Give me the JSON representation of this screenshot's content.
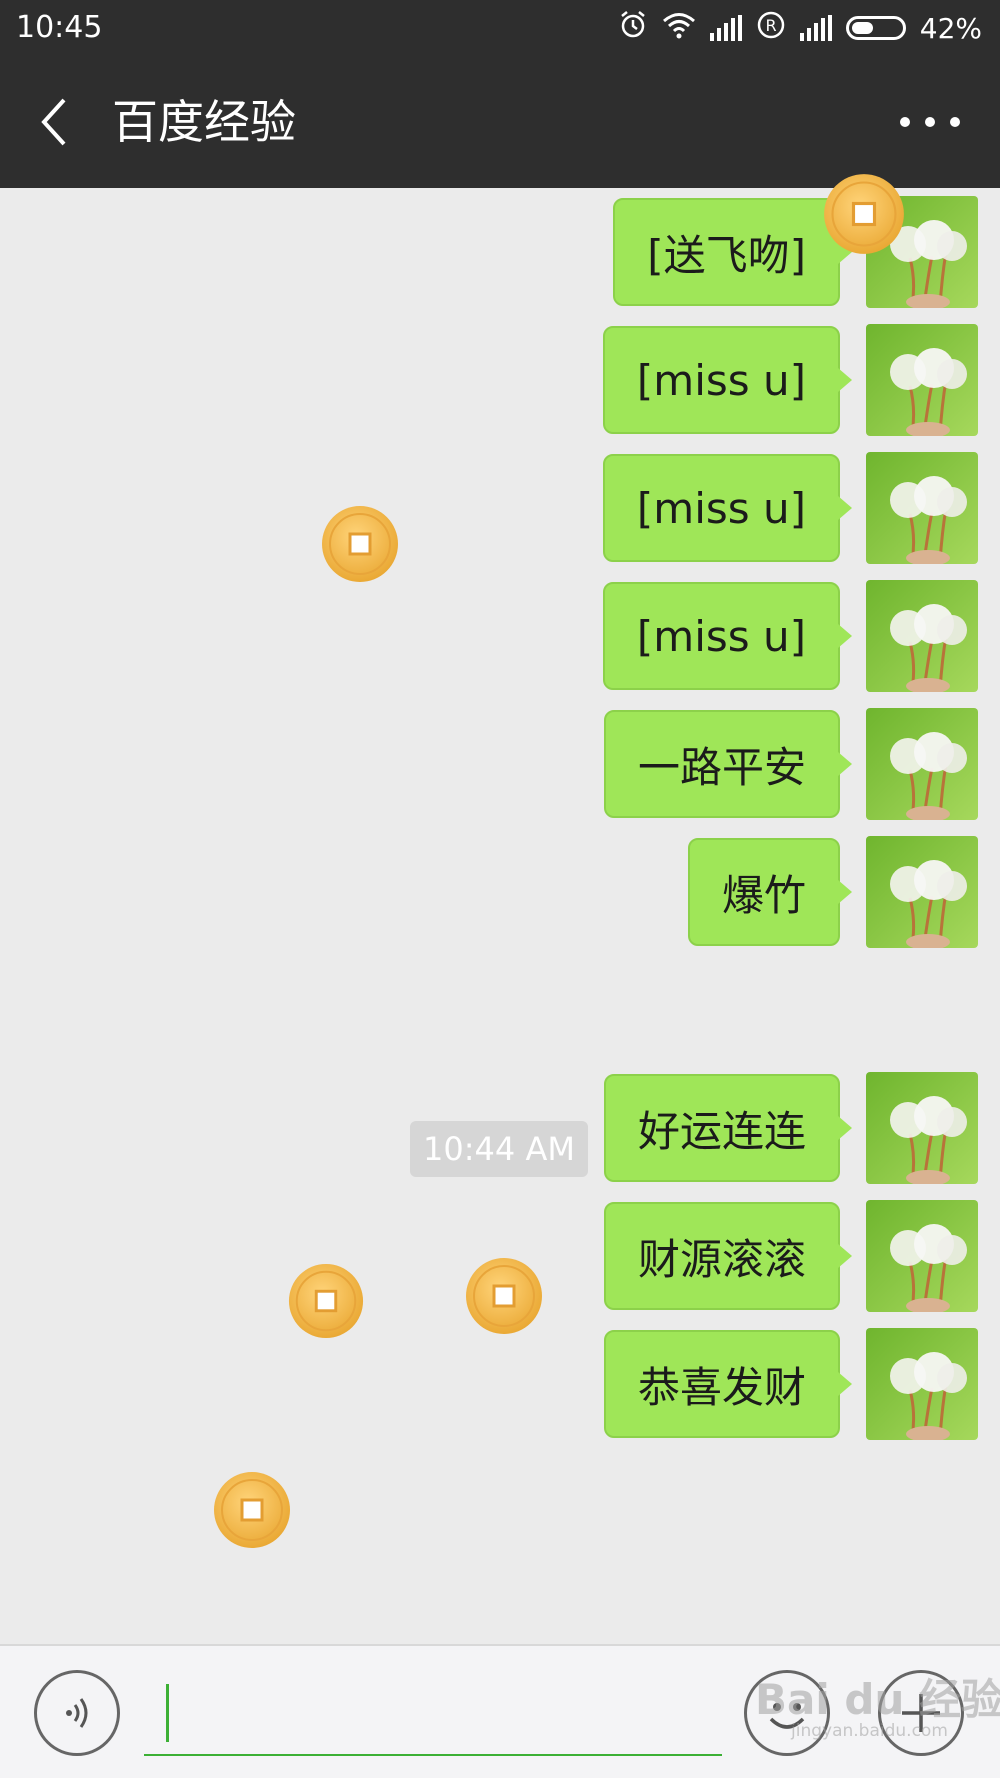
{
  "status_bar": {
    "time": "10:45",
    "battery": "42%",
    "battery_level": 0.42,
    "icons": [
      "alarm-icon",
      "wifi-icon",
      "signal-icon",
      "registered-icon",
      "signal-icon",
      "battery-icon"
    ]
  },
  "header": {
    "title": "百度经验",
    "back_icon": "chevron-left-icon",
    "more_icon": "more-dots-icon"
  },
  "messages": [
    {
      "text": "[送飞吻]"
    },
    {
      "text": "[miss u]"
    },
    {
      "text": "[miss u]"
    },
    {
      "text": "[miss u]"
    },
    {
      "text": "一路平安"
    },
    {
      "text": "爆竹"
    },
    {
      "text": "好运连连"
    },
    {
      "text": "财源滚滚"
    },
    {
      "text": "恭喜发财"
    }
  ],
  "timestamp": "10:44 AM",
  "input_bar": {
    "voice_icon": "voice-icon",
    "emoji_icon": "emoji-icon",
    "plus_icon": "plus-icon",
    "text_value": ""
  },
  "watermark": {
    "brand": "Bai du 经验",
    "url": "jingyan.baidu.com"
  },
  "colors": {
    "bubble": "#9fe658",
    "header": "#2e2e2e",
    "background": "#ebebeb",
    "coin": "#f2b94a"
  }
}
